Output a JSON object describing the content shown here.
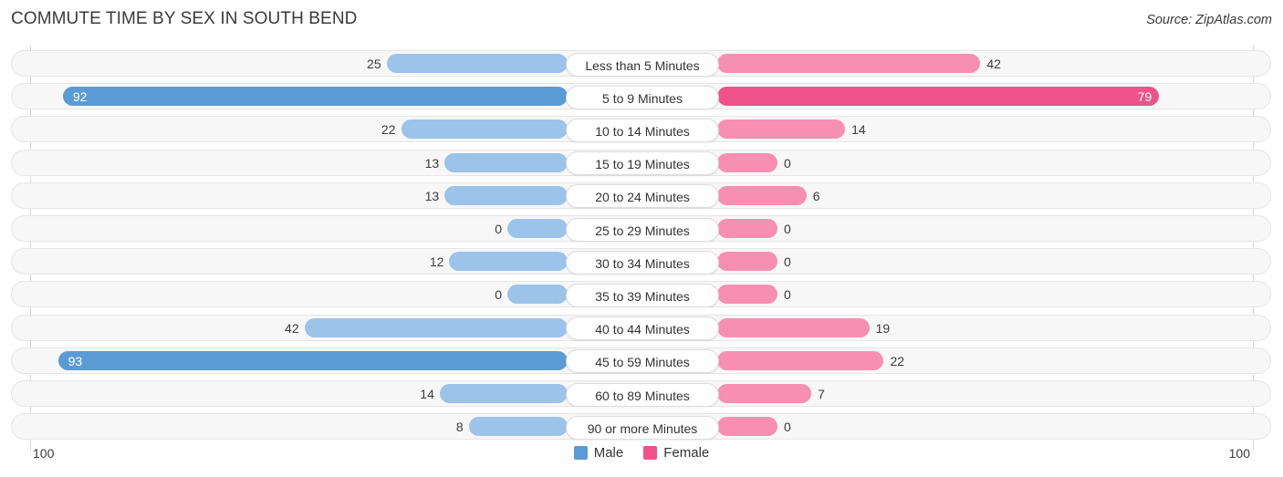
{
  "title": "COMMUTE TIME BY SEX IN SOUTH BEND",
  "source": "Source: ZipAtlas.com",
  "axis": {
    "left_label": "100",
    "right_label": "100",
    "max": 100
  },
  "legend": {
    "male": {
      "label": "Male",
      "color": "#5B9BD5"
    },
    "female": {
      "label": "Female",
      "color": "#F0538A"
    }
  },
  "colors": {
    "male_light": "#9CC3E9",
    "male_dark": "#5B9BD5",
    "female_light": "#F78FB3",
    "female_dark": "#F0538A",
    "row_bg": "#F7F7F7",
    "row_border": "#E6E6E6",
    "text": "#3B3B3B"
  },
  "chart_data": {
    "type": "bar",
    "title": "COMMUTE TIME BY SEX IN SOUTH BEND",
    "subtitle": "",
    "orientation": "horizontal-diverging",
    "xlabel": "",
    "ylabel": "",
    "xlim": [
      100,
      100
    ],
    "grid": false,
    "legend_position": "bottom-center",
    "categories": [
      "Less than 5 Minutes",
      "5 to 9 Minutes",
      "10 to 14 Minutes",
      "15 to 19 Minutes",
      "20 to 24 Minutes",
      "25 to 29 Minutes",
      "30 to 34 Minutes",
      "35 to 39 Minutes",
      "40 to 44 Minutes",
      "45 to 59 Minutes",
      "60 to 89 Minutes",
      "90 or more Minutes"
    ],
    "series": [
      {
        "name": "Male",
        "values": [
          25,
          92,
          22,
          13,
          13,
          0,
          12,
          0,
          42,
          93,
          14,
          8
        ]
      },
      {
        "name": "Female",
        "values": [
          42,
          79,
          14,
          0,
          6,
          0,
          0,
          0,
          19,
          22,
          7,
          0
        ]
      }
    ]
  },
  "rows": [
    {
      "category": "Less than 5 Minutes",
      "male": 25,
      "female": 42,
      "male_label": "25",
      "female_label": "42"
    },
    {
      "category": "5 to 9 Minutes",
      "male": 92,
      "female": 79,
      "male_label": "92",
      "female_label": "79"
    },
    {
      "category": "10 to 14 Minutes",
      "male": 22,
      "female": 14,
      "male_label": "22",
      "female_label": "14"
    },
    {
      "category": "15 to 19 Minutes",
      "male": 13,
      "female": 0,
      "male_label": "13",
      "female_label": "0"
    },
    {
      "category": "20 to 24 Minutes",
      "male": 13,
      "female": 6,
      "male_label": "13",
      "female_label": "6"
    },
    {
      "category": "25 to 29 Minutes",
      "male": 0,
      "female": 0,
      "male_label": "0",
      "female_label": "0"
    },
    {
      "category": "30 to 34 Minutes",
      "male": 12,
      "female": 0,
      "male_label": "12",
      "female_label": "0"
    },
    {
      "category": "35 to 39 Minutes",
      "male": 0,
      "female": 0,
      "male_label": "0",
      "female_label": "0"
    },
    {
      "category": "40 to 44 Minutes",
      "male": 42,
      "female": 19,
      "male_label": "42",
      "female_label": "19"
    },
    {
      "category": "45 to 59 Minutes",
      "male": 93,
      "female": 22,
      "male_label": "93",
      "female_label": "22"
    },
    {
      "category": "60 to 89 Minutes",
      "male": 14,
      "female": 7,
      "male_label": "14",
      "female_label": "7"
    },
    {
      "category": "90 or more Minutes",
      "male": 8,
      "female": 0,
      "male_label": "8",
      "female_label": "0"
    }
  ]
}
